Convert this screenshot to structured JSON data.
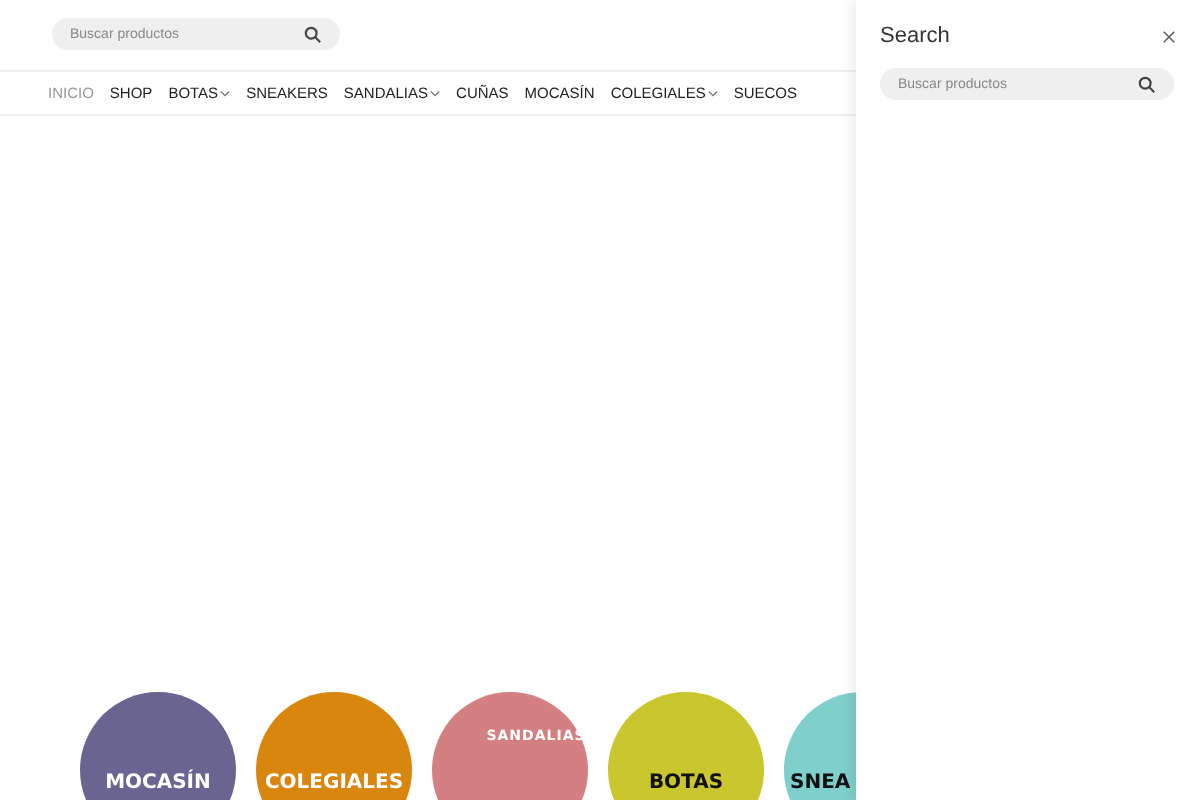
{
  "header": {
    "search": {
      "placeholder": "Buscar productos"
    }
  },
  "nav": [
    {
      "label": "INICIO",
      "selected": true,
      "kind": "link"
    },
    {
      "label": "SHOP",
      "selected": false,
      "kind": "link"
    },
    {
      "label": "BOTAS",
      "selected": false,
      "kind": "dropdown"
    },
    {
      "label": "SNEAKERS",
      "selected": false,
      "kind": "link"
    },
    {
      "label": "SANDALIAS",
      "selected": false,
      "kind": "dropdown"
    },
    {
      "label": "CUÑAS",
      "selected": false,
      "kind": "link"
    },
    {
      "label": "MOCASÍN",
      "selected": false,
      "kind": "link"
    },
    {
      "label": "COLEGIALES",
      "selected": false,
      "kind": "dropdown"
    },
    {
      "label": "SUECOS",
      "selected": false,
      "kind": "link"
    }
  ],
  "categories": [
    {
      "label": "MOCASÍN",
      "color": "#6a6590",
      "kind": "light"
    },
    {
      "label": "COLEGIALES",
      "color": "#d9860f",
      "kind": "light"
    },
    {
      "label": "SANDALIAS",
      "color": "#d47f82",
      "kind": "top"
    },
    {
      "label": "BOTAS",
      "color": "#c9c62e",
      "kind": "dark"
    },
    {
      "label": "SNEA",
      "color": "#7fcfcc",
      "kind": "edge"
    }
  ],
  "search_panel": {
    "title": "Search",
    "placeholder": "Buscar productos"
  }
}
